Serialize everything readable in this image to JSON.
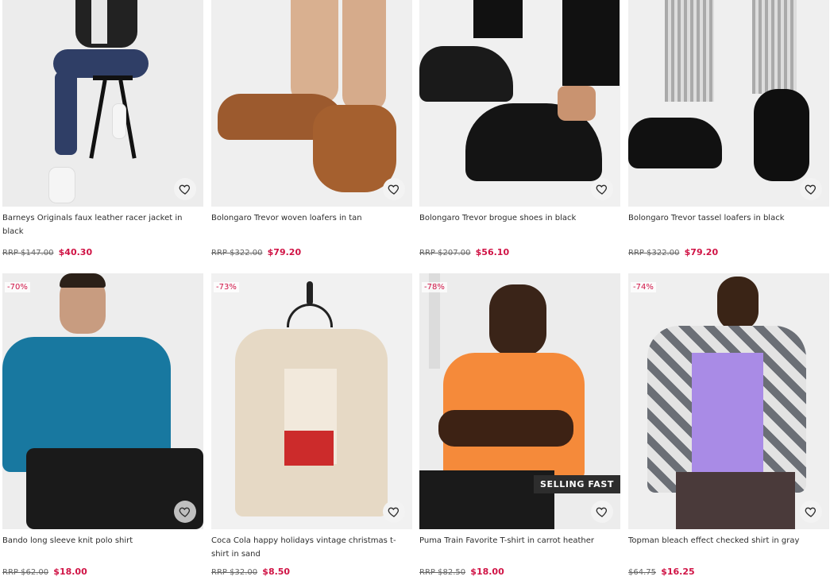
{
  "products": [
    {
      "title": "Barneys Originals faux leather racer jacket in black",
      "rrp": "RRP $147.00",
      "price": "$40.30",
      "discount": "",
      "badge": ""
    },
    {
      "title": "Bolongaro Trevor woven loafers in tan",
      "rrp": "RRP $322.00",
      "price": "$79.20",
      "discount": "",
      "badge": ""
    },
    {
      "title": "Bolongaro Trevor brogue shoes in black",
      "rrp": "RRP $207.00",
      "price": "$56.10",
      "discount": "",
      "badge": ""
    },
    {
      "title": "Bolongaro Trevor tassel loafers in black",
      "rrp": "RRP $322.00",
      "price": "$79.20",
      "discount": "",
      "badge": ""
    },
    {
      "title": "Bando long sleeve knit polo shirt",
      "rrp": "RRP $62.00",
      "price": "$18.00",
      "discount": "-70%",
      "badge": ""
    },
    {
      "title": "Coca Cola happy holidays vintage christmas t-shirt in sand",
      "rrp": "RRP $32.00",
      "price": "$8.50",
      "discount": "-73%",
      "badge": ""
    },
    {
      "title": "Puma Train Favorite T-shirt in carrot heather",
      "rrp": "RRP $82.50",
      "price": "$18.00",
      "discount": "-78%",
      "badge": "SELLING FAST"
    },
    {
      "title": "Topman bleach effect checked shirt in gray",
      "rrp": "$64.75",
      "price": "$16.25",
      "discount": "-74%",
      "badge": ""
    }
  ],
  "icons": {
    "wishlist": "heart-outline-icon"
  },
  "colors": {
    "sale": "#d01345",
    "text": "#2d2d2d",
    "badge_bg": "#2d2d2d"
  }
}
